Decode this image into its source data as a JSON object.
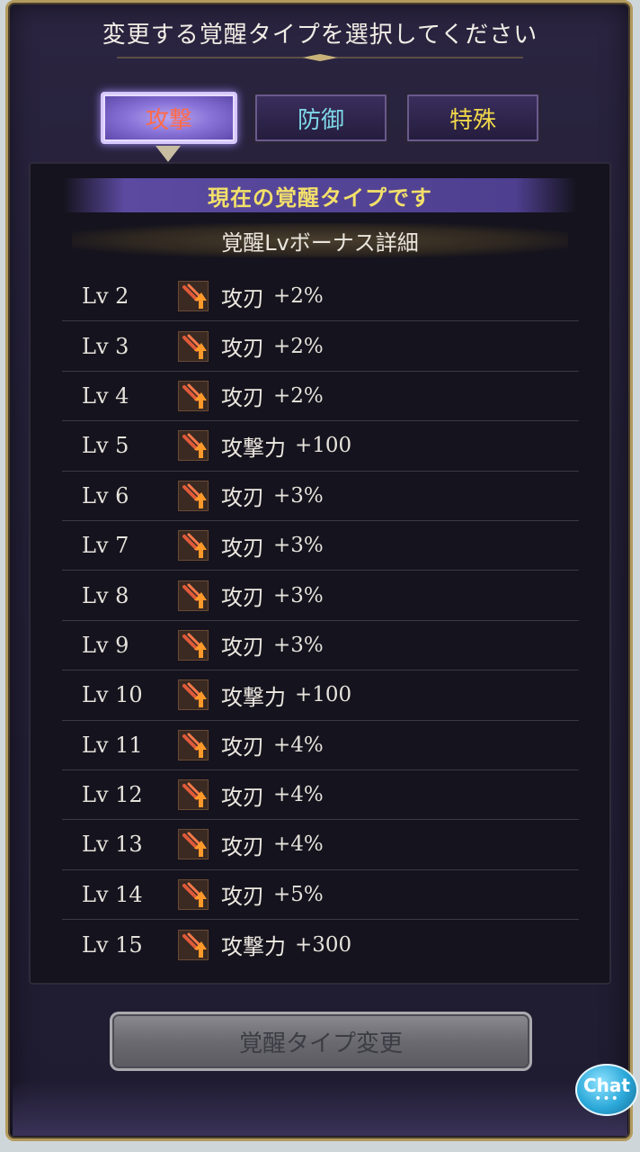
{
  "dialog": {
    "title": "変更する覚醒タイプを選択してください"
  },
  "tabs": [
    {
      "label": "攻撃",
      "color": "#ff6a4a",
      "active": true
    },
    {
      "label": "防御",
      "color": "#7fd8e8",
      "active": false
    },
    {
      "label": "特殊",
      "color": "#f2d84a",
      "active": false
    }
  ],
  "current_type_label": "現在の覚醒タイプです",
  "detail_header": "覚醒Lvボーナス詳細",
  "bonuses": [
    {
      "level": "Lv 2",
      "skill": "攻刃",
      "value": "+2%",
      "icon": "sword-up-icon"
    },
    {
      "level": "Lv 3",
      "skill": "攻刃",
      "value": "+2%",
      "icon": "sword-up-icon"
    },
    {
      "level": "Lv 4",
      "skill": "攻刃",
      "value": "+2%",
      "icon": "sword-up-icon"
    },
    {
      "level": "Lv 5",
      "skill": "攻撃力",
      "value": "+100",
      "icon": "sword-up-icon"
    },
    {
      "level": "Lv 6",
      "skill": "攻刃",
      "value": "+3%",
      "icon": "sword-up-icon"
    },
    {
      "level": "Lv 7",
      "skill": "攻刃",
      "value": "+3%",
      "icon": "sword-up-icon"
    },
    {
      "level": "Lv 8",
      "skill": "攻刃",
      "value": "+3%",
      "icon": "sword-up-icon"
    },
    {
      "level": "Lv 9",
      "skill": "攻刃",
      "value": "+3%",
      "icon": "sword-up-icon"
    },
    {
      "level": "Lv 10",
      "skill": "攻撃力",
      "value": "+100",
      "icon": "sword-up-icon"
    },
    {
      "level": "Lv 11",
      "skill": "攻刃",
      "value": "+4%",
      "icon": "sword-up-icon"
    },
    {
      "level": "Lv 12",
      "skill": "攻刃",
      "value": "+4%",
      "icon": "sword-up-icon"
    },
    {
      "level": "Lv 13",
      "skill": "攻刃",
      "value": "+4%",
      "icon": "sword-up-icon"
    },
    {
      "level": "Lv 14",
      "skill": "攻刃",
      "value": "+5%",
      "icon": "sword-up-icon"
    },
    {
      "level": "Lv 15",
      "skill": "攻撃力",
      "value": "+300",
      "icon": "sword-up-icon"
    }
  ],
  "change_button_label": "覚醒タイプ変更",
  "chat": {
    "label": "Chat",
    "dots": "•••"
  }
}
